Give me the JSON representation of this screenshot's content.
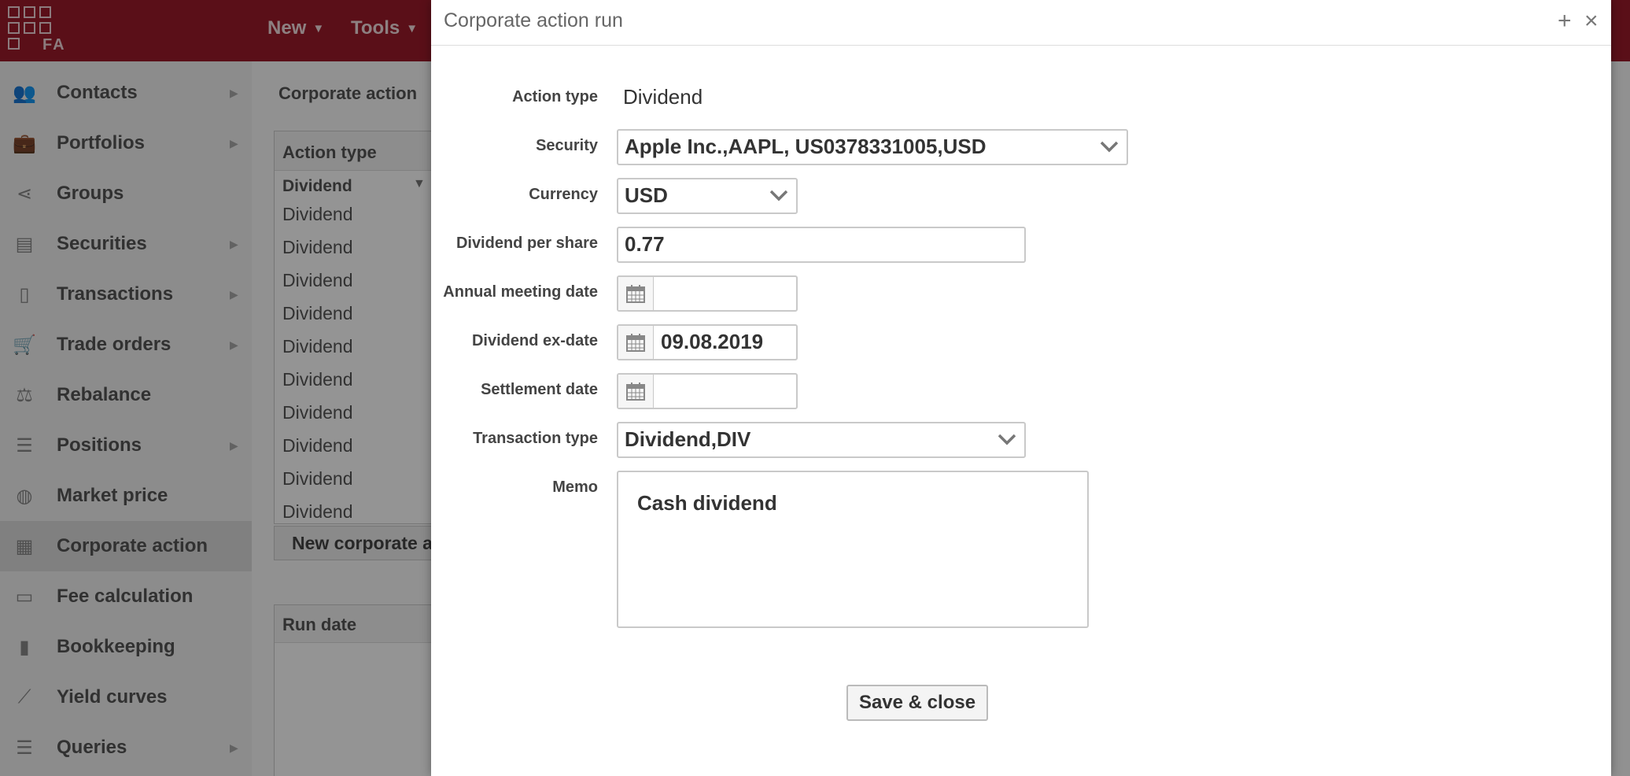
{
  "header": {
    "logo_text": "FA",
    "nav": [
      {
        "label": "New"
      },
      {
        "label": "Tools"
      }
    ]
  },
  "sidebar": {
    "items": [
      {
        "label": "Contacts",
        "icon": "contacts-icon",
        "has_arrow": true
      },
      {
        "label": "Portfolios",
        "icon": "briefcase-icon",
        "has_arrow": true
      },
      {
        "label": "Groups",
        "icon": "share-icon",
        "has_arrow": false
      },
      {
        "label": "Securities",
        "icon": "securities-icon",
        "has_arrow": true
      },
      {
        "label": "Transactions",
        "icon": "document-icon",
        "has_arrow": true
      },
      {
        "label": "Trade orders",
        "icon": "cart-icon",
        "has_arrow": true
      },
      {
        "label": "Rebalance",
        "icon": "scale-icon",
        "has_arrow": false
      },
      {
        "label": "Positions",
        "icon": "list-icon",
        "has_arrow": true
      },
      {
        "label": "Market price",
        "icon": "coins-icon",
        "has_arrow": false
      },
      {
        "label": "Corporate action",
        "icon": "building-icon",
        "has_arrow": false,
        "active": true
      },
      {
        "label": "Fee calculation",
        "icon": "invoice-icon",
        "has_arrow": false
      },
      {
        "label": "Bookkeeping",
        "icon": "book-icon",
        "has_arrow": false
      },
      {
        "label": "Yield curves",
        "icon": "line-chart-icon",
        "has_arrow": false
      },
      {
        "label": "Queries",
        "icon": "list-icon",
        "has_arrow": true
      }
    ]
  },
  "main": {
    "title": "Corporate action",
    "table": {
      "header": "Action type",
      "filter_value": "Dividend",
      "rows": [
        "Dividend",
        "Dividend",
        "Dividend",
        "Dividend",
        "Dividend",
        "Dividend",
        "Dividend",
        "Dividend",
        "Dividend",
        "Dividend"
      ]
    },
    "new_button_label": "New corporate a",
    "run_table_header": "Run date"
  },
  "modal": {
    "title": "Corporate action run",
    "fields": {
      "action_type": {
        "label": "Action type",
        "value": "Dividend"
      },
      "security": {
        "label": "Security",
        "value": "Apple Inc.,AAPL, US0378331005,USD"
      },
      "currency": {
        "label": "Currency",
        "value": "USD"
      },
      "dividend_per_share": {
        "label": "Dividend per share",
        "value": "0.77"
      },
      "annual_meeting_date": {
        "label": "Annual meeting date",
        "value": ""
      },
      "dividend_ex_date": {
        "label": "Dividend ex-date",
        "value": "09.08.2019"
      },
      "settlement_date": {
        "label": "Settlement date",
        "value": ""
      },
      "transaction_type": {
        "label": "Transaction type",
        "value": "Dividend,DIV"
      },
      "memo": {
        "label": "Memo",
        "value": "Cash dividend"
      }
    },
    "save_label": "Save & close"
  },
  "colors": {
    "brand": "#9b1b2a",
    "overlay": "rgba(0,0,0,0.42)"
  }
}
